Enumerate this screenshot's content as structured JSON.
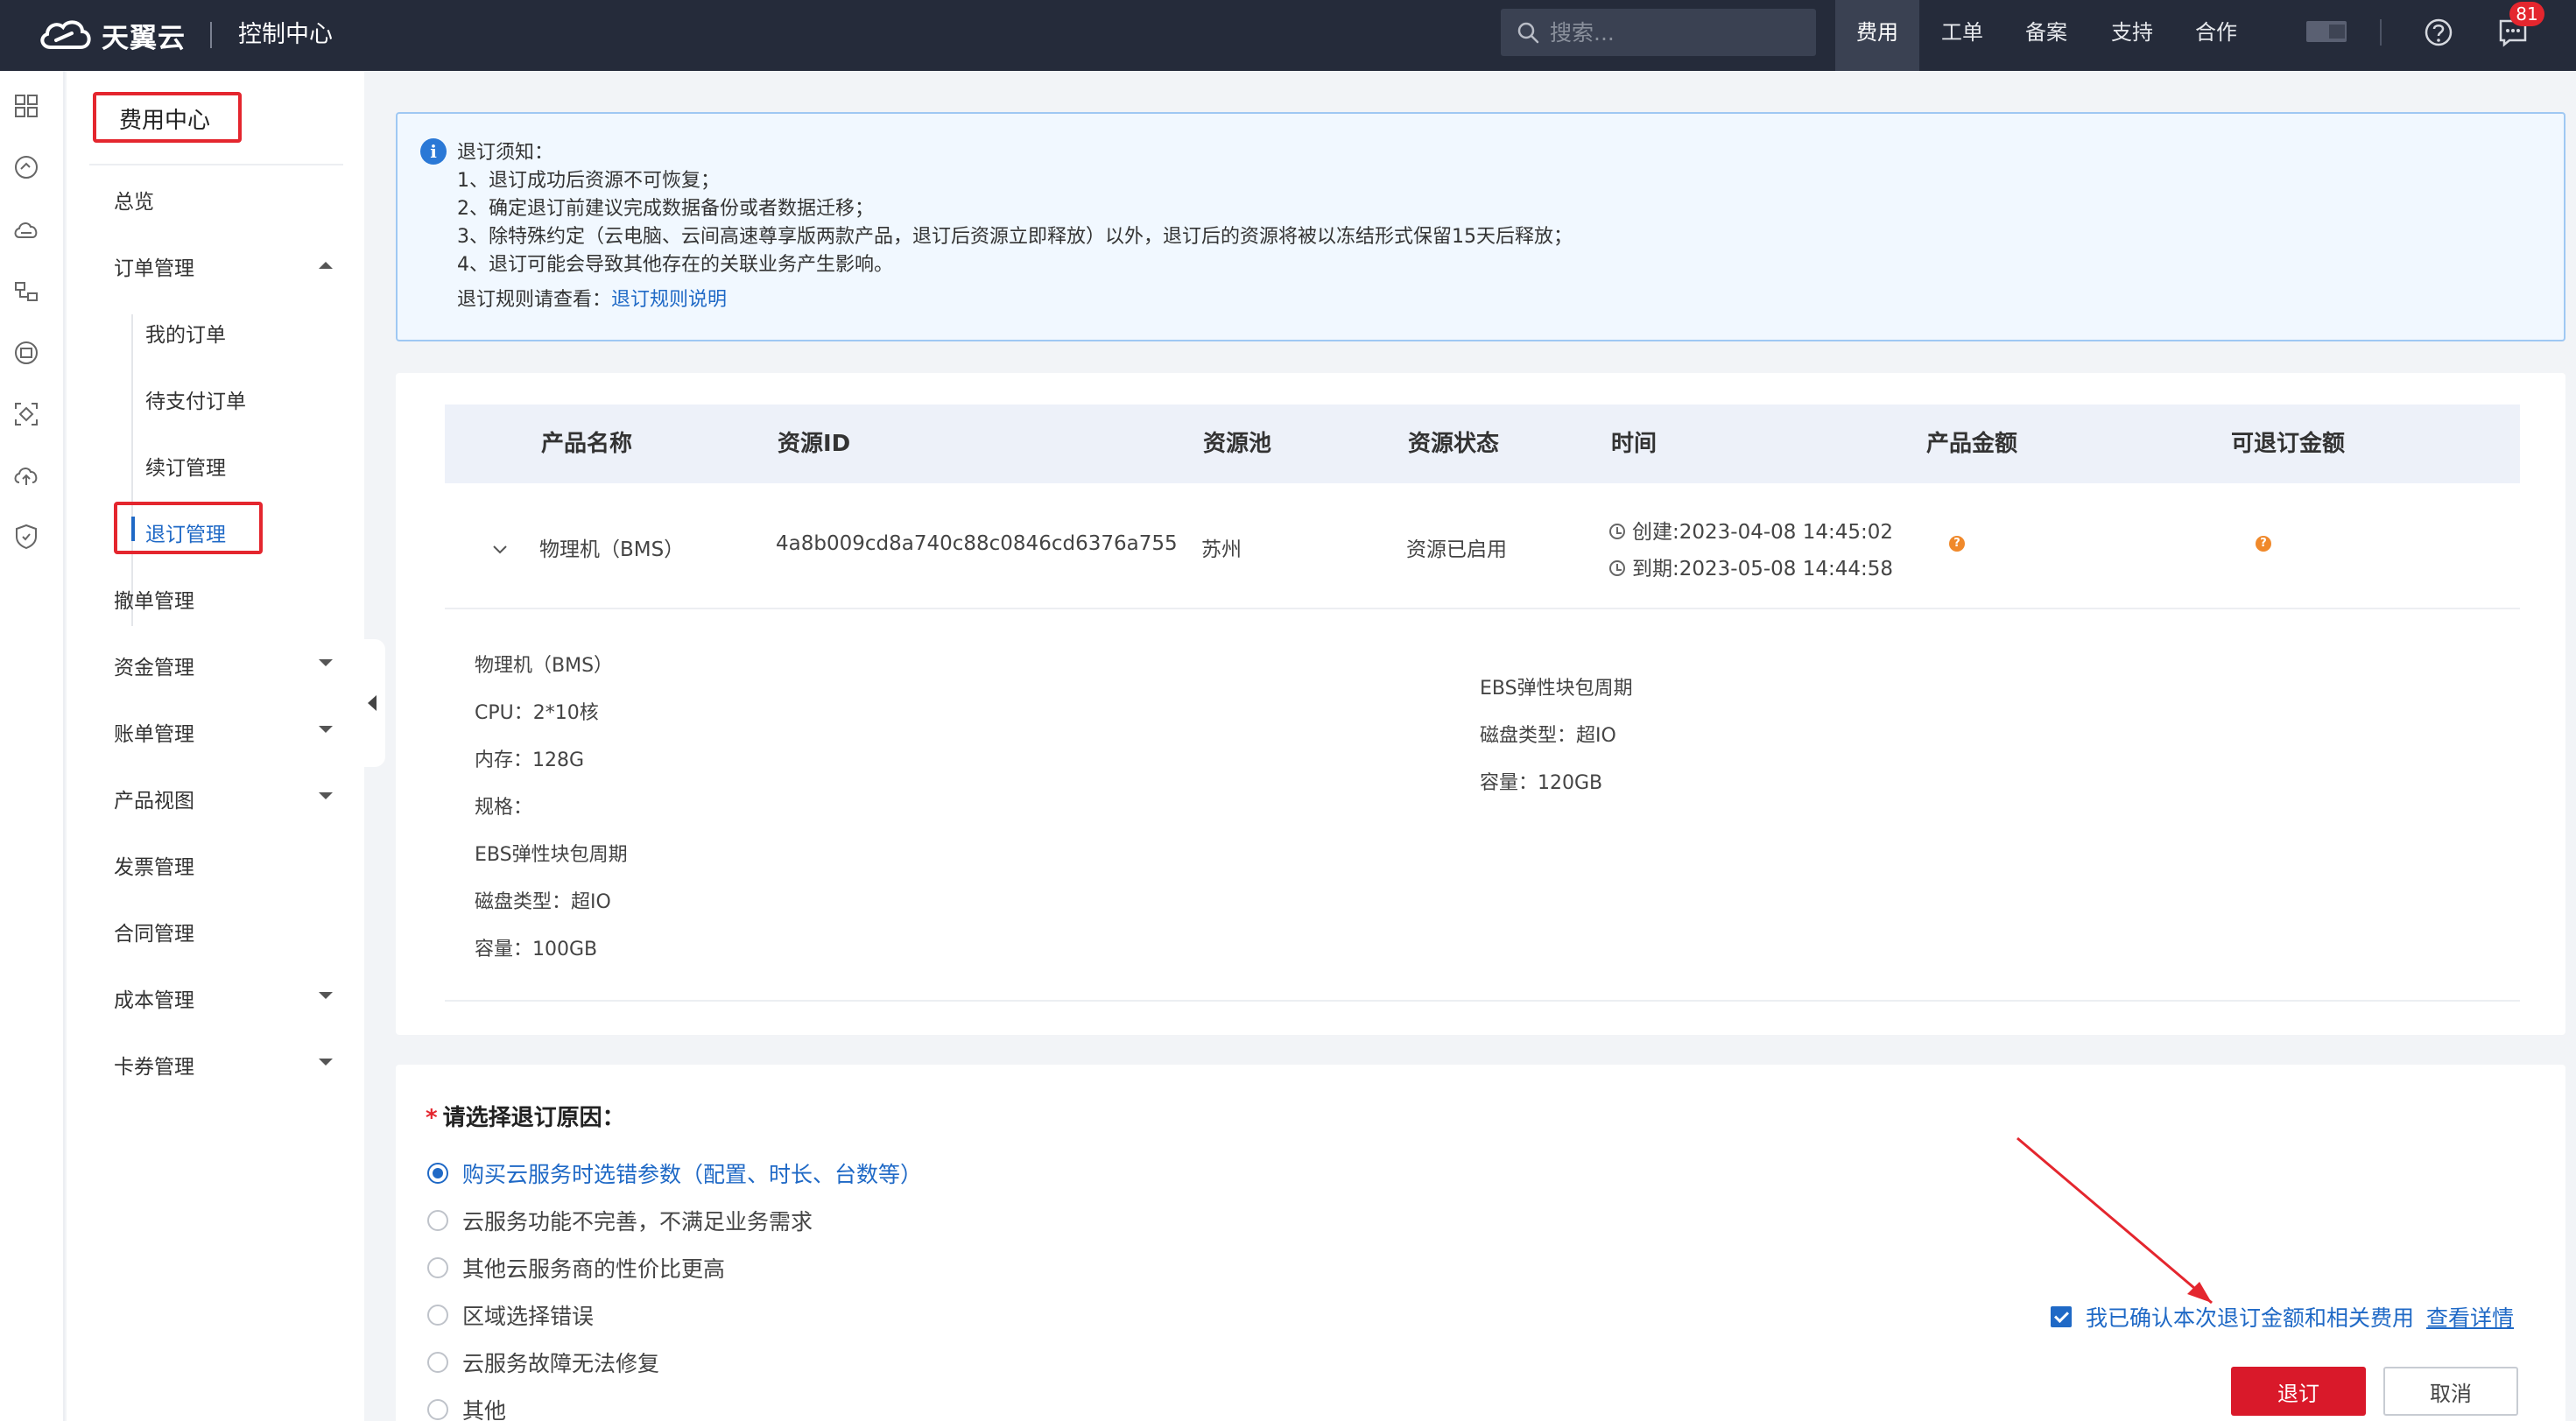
{
  "topbar": {
    "brand": "天翼云",
    "console_title": "控制中心",
    "search_placeholder": "搜索...",
    "nav": [
      "费用",
      "工单",
      "备案",
      "支持",
      "合作"
    ],
    "active_nav": "费用",
    "message_count": "81"
  },
  "sidebar": {
    "title": "费用中心",
    "items": {
      "overview": "总览",
      "orders": "订单管理",
      "my_orders": "我的订单",
      "pending_orders": "待支付订单",
      "renewals": "续订管理",
      "unsubscribe": "退订管理",
      "cancel_orders": "撤单管理",
      "funds": "资金管理",
      "bills": "账单管理",
      "product_view": "产品视图",
      "invoices": "发票管理",
      "contracts": "合同管理",
      "costs": "成本管理",
      "coupons": "卡券管理"
    }
  },
  "notice": {
    "title": "退订须知：",
    "lines": [
      "1、退订成功后资源不可恢复；",
      "2、确定退订前建议完成数据备份或者数据迁移；",
      "3、除特殊约定（云电脑、云间高速尊享版两款产品，退订后资源立即释放）以外，退订后的资源将被以冻结形式保留15天后释放；",
      "4、退订可能会导致其他存在的关联业务产生影响。"
    ],
    "rules_prefix": "退订规则请查看：",
    "rules_link": "退订规则说明"
  },
  "table": {
    "headers": {
      "product": "产品名称",
      "resource_id": "资源ID",
      "pool": "资源池",
      "status": "资源状态",
      "time": "时间",
      "amount": "产品金额",
      "refundable": "可退订金额"
    },
    "row": {
      "product": "物理机（BMS）",
      "resource_id": "4a8b009cd8a740c88c0846cd6376a755",
      "pool": "苏州",
      "status": "资源已启用",
      "created": "创建:2023-04-08 14:45:02",
      "expires": "到期:2023-05-08 14:44:58"
    },
    "details_left": [
      "物理机（BMS）",
      "CPU：2*10核",
      "内存：128G",
      "规格：",
      "EBS弹性块包周期",
      "磁盘类型：超IO",
      "容量：100GB"
    ],
    "details_right": [
      "EBS弹性块包周期",
      "磁盘类型：超IO",
      "容量：120GB"
    ]
  },
  "reason": {
    "title": "请选择退订原因：",
    "required_mark": "*",
    "options": [
      "购买云服务时选错参数（配置、时长、台数等）",
      "云服务功能不完善，不满足业务需求",
      "其他云服务商的性价比更高",
      "区域选择错误",
      "云服务故障无法修复",
      "其他"
    ],
    "selected_index": 0,
    "confirm_text": "我已确认本次退订金额和相关费用",
    "detail_link": "查看详情",
    "submit_label": "退订",
    "cancel_label": "取消"
  },
  "colors": {
    "topbar": "#252b3a",
    "accent_blue": "#1f69c6",
    "primary_red": "#d9192a",
    "highlight_red": "#e4262e",
    "warning_orange": "#f0892b"
  }
}
